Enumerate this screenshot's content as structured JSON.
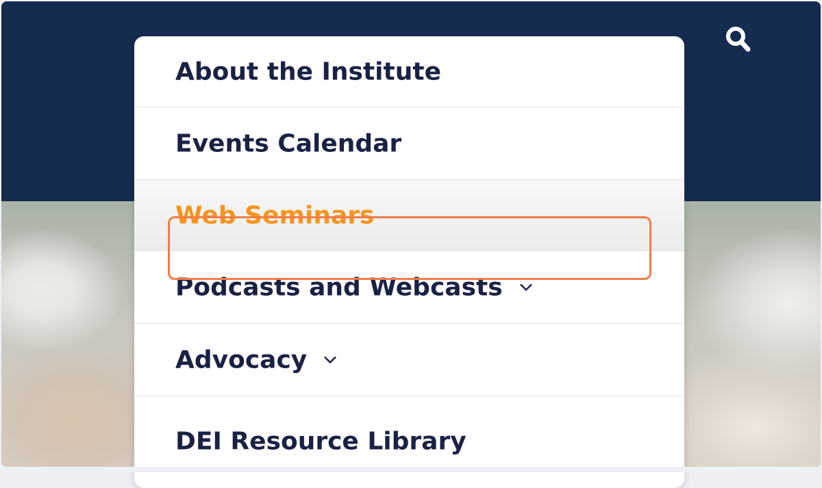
{
  "header": {
    "search_icon": "search-icon",
    "color": "#162b50"
  },
  "menu": {
    "items": [
      {
        "label": "About the Institute",
        "has_submenu": false
      },
      {
        "label": "Events Calendar",
        "has_submenu": false
      },
      {
        "label": "Web Seminars",
        "has_submenu": false,
        "active": true
      },
      {
        "label": "Podcasts and Webcasts",
        "has_submenu": true
      },
      {
        "label": "Advocacy",
        "has_submenu": true
      },
      {
        "label": "DEI Resource Library",
        "has_submenu": false
      }
    ]
  },
  "colors": {
    "active_text": "#f7941d",
    "highlight_border": "#f47b46",
    "item_text": "#1a2244"
  }
}
